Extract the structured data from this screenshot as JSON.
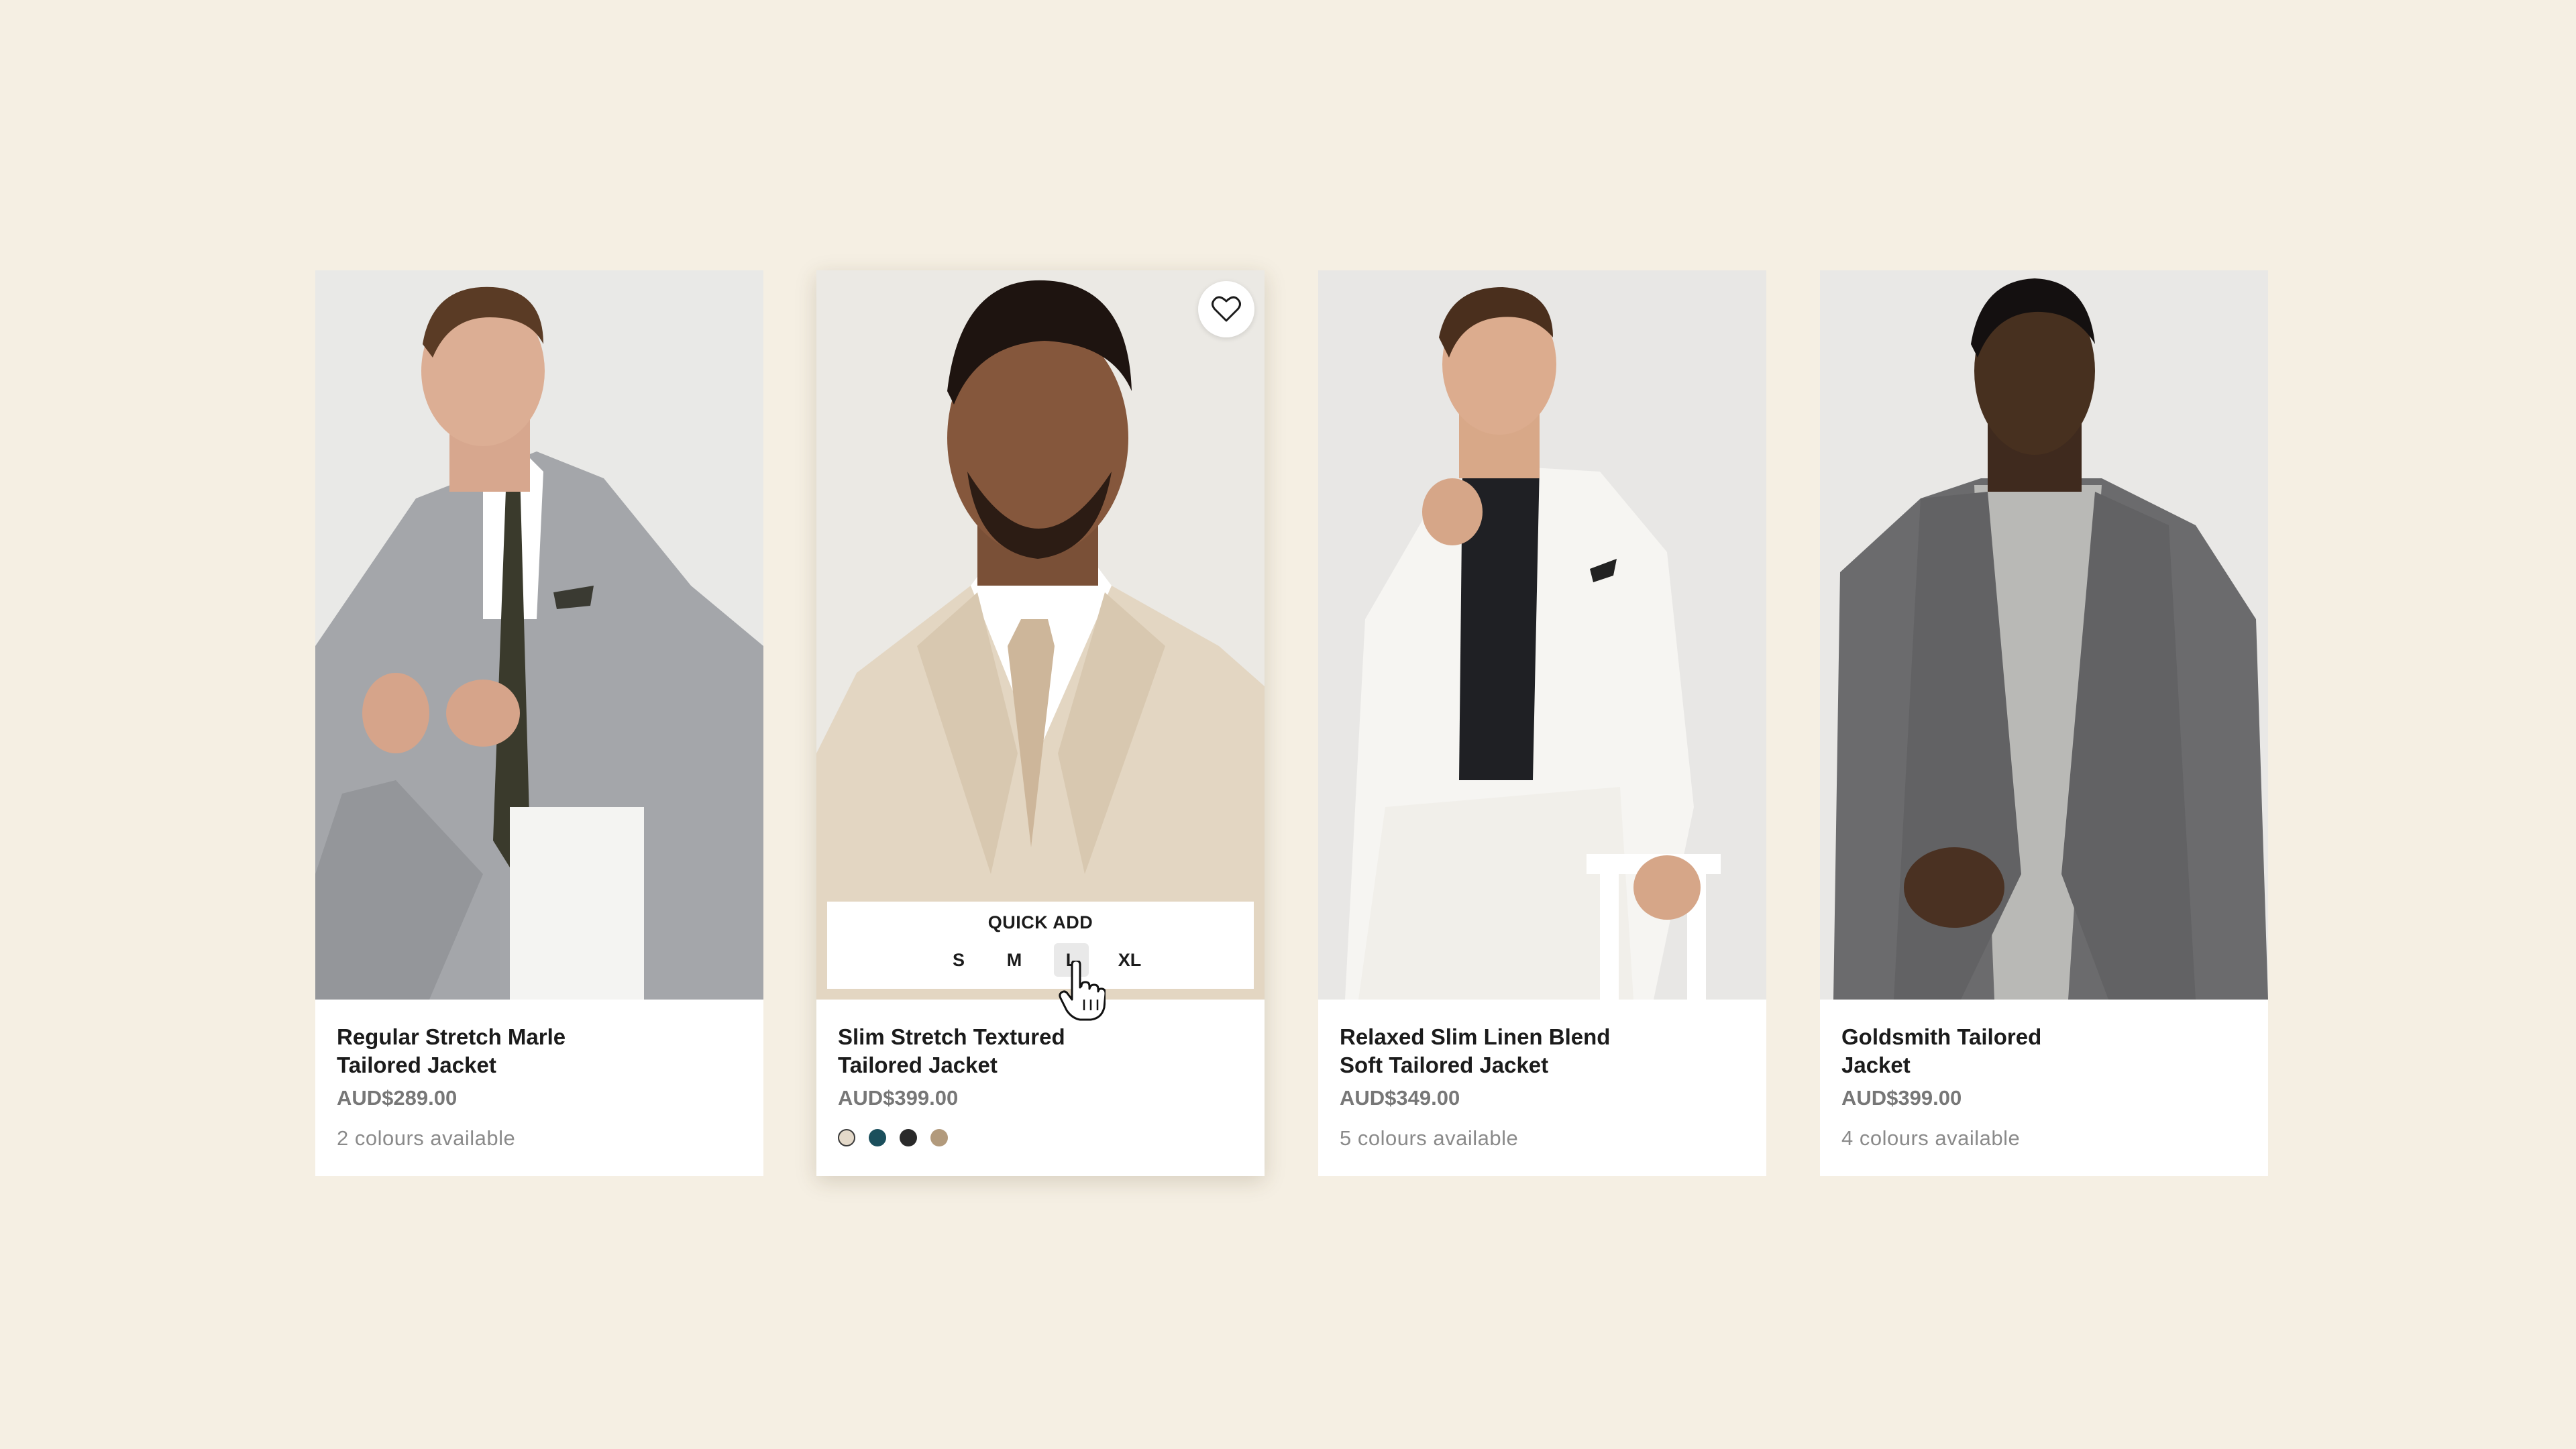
{
  "products": [
    {
      "name_line1": "Regular Stretch Marle",
      "name_line2": "Tailored Jacket",
      "price": "AUD$289.00",
      "colours_text": "2 colours available"
    },
    {
      "name_line1": "Slim Stretch Textured",
      "name_line2": "Tailored Jacket",
      "price": "AUD$399.00",
      "swatches": [
        "#e4d9c9",
        "#1b4f5c",
        "#2a2a2a",
        "#b29a7c"
      ],
      "quick_add": {
        "label": "QUICK ADD",
        "sizes": [
          "S",
          "M",
          "L",
          "XL"
        ],
        "hovered_size": "L"
      }
    },
    {
      "name_line1": "Relaxed Slim Linen Blend",
      "name_line2": "Soft Tailored Jacket",
      "price": "AUD$349.00",
      "colours_text": "5 colours available"
    },
    {
      "name_line1": "Goldsmith Tailored",
      "name_line2": "Jacket",
      "price": "AUD$399.00",
      "colours_text": "4 colours available"
    }
  ],
  "icons": {
    "wishlist": "heart-icon",
    "pointer": "hand-pointer-icon"
  },
  "colors": {
    "background": "#f5efe3",
    "card": "#ffffff",
    "price": "#777777",
    "meta": "#8a8a8a"
  }
}
